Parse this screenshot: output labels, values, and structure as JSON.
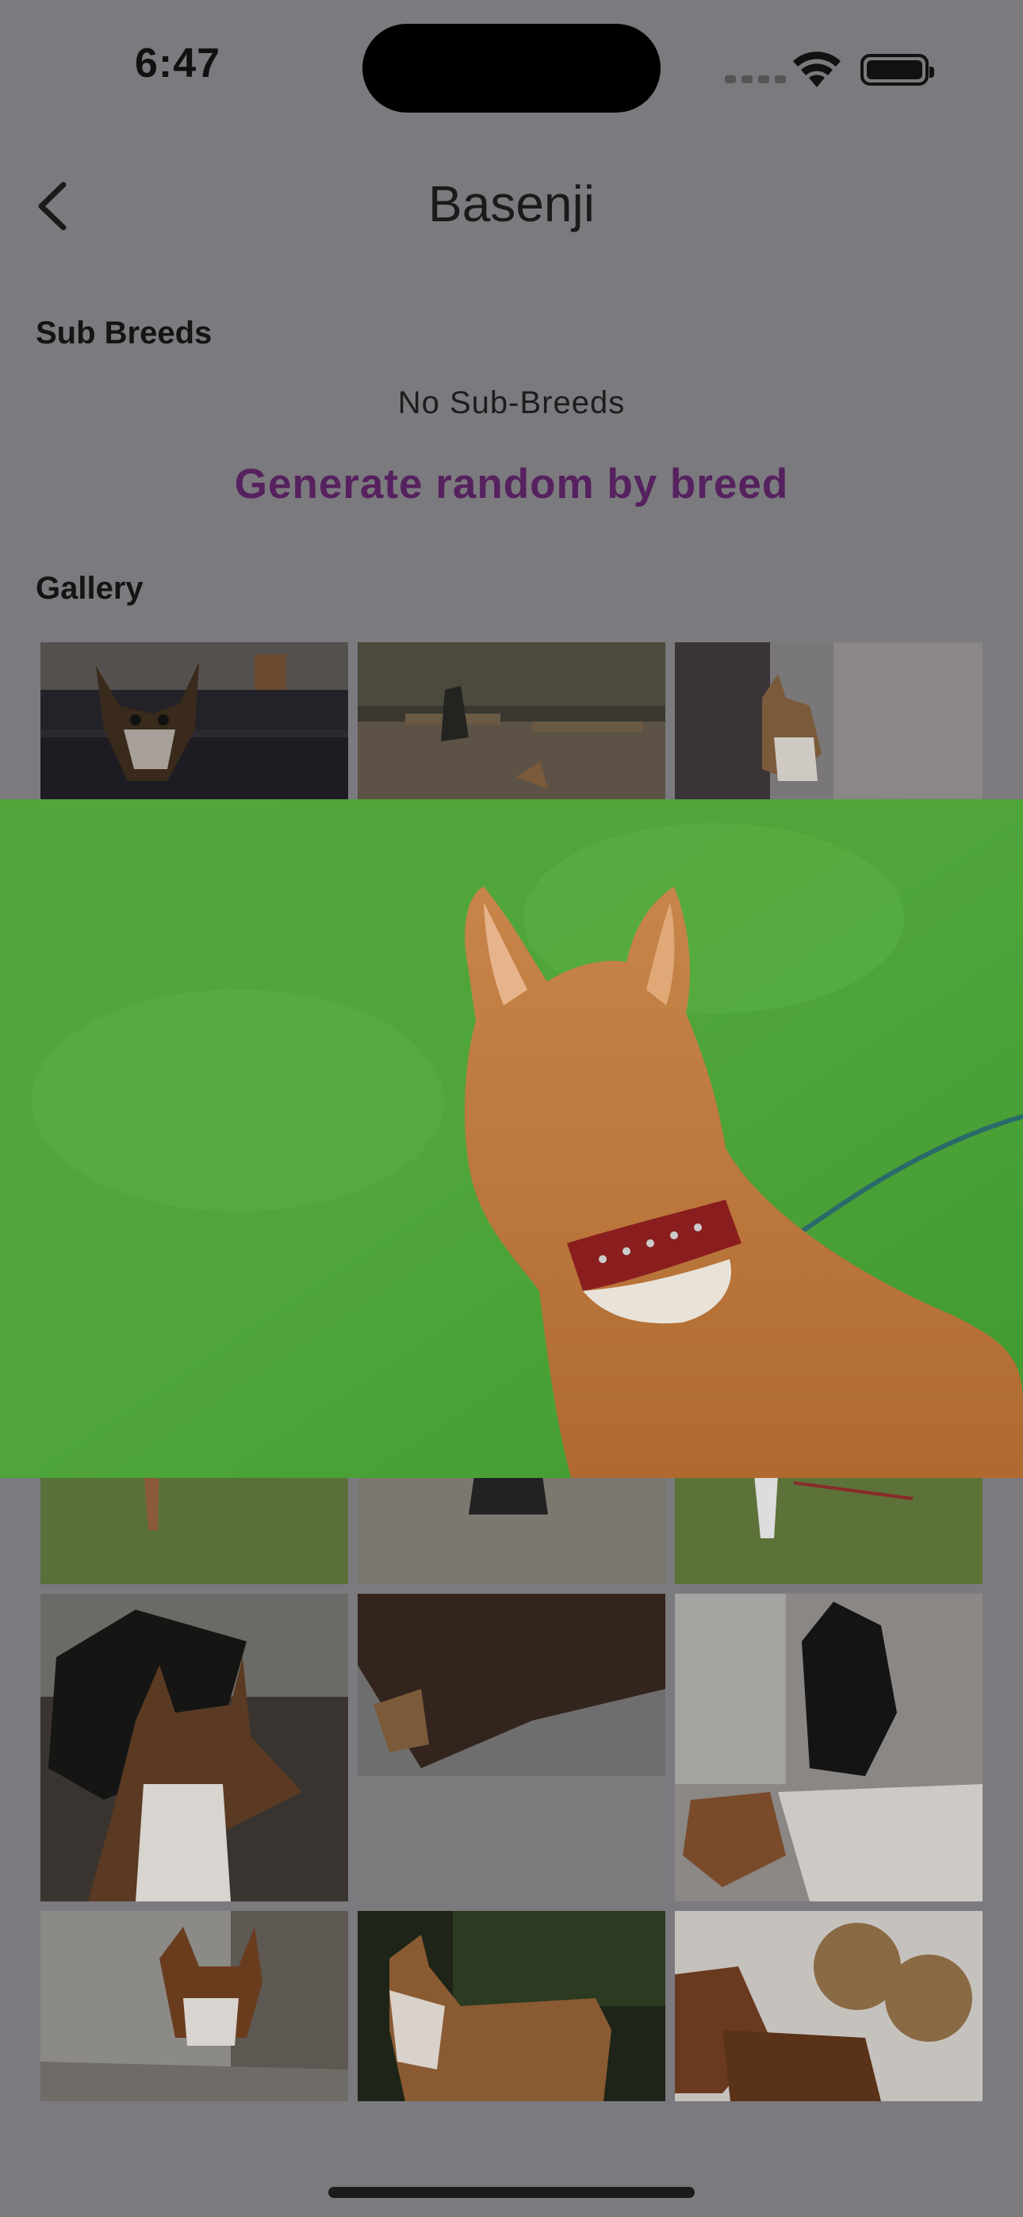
{
  "status_bar": {
    "time": "6:47"
  },
  "nav": {
    "title": "Basenji"
  },
  "sub_breeds": {
    "heading": "Sub Breeds",
    "empty_text": "No Sub-Breeds",
    "generate_label": "Generate random by breed"
  },
  "gallery": {
    "heading": "Gallery"
  },
  "colors": {
    "accent": "#56215f",
    "scrim": "#7b7a7e"
  }
}
